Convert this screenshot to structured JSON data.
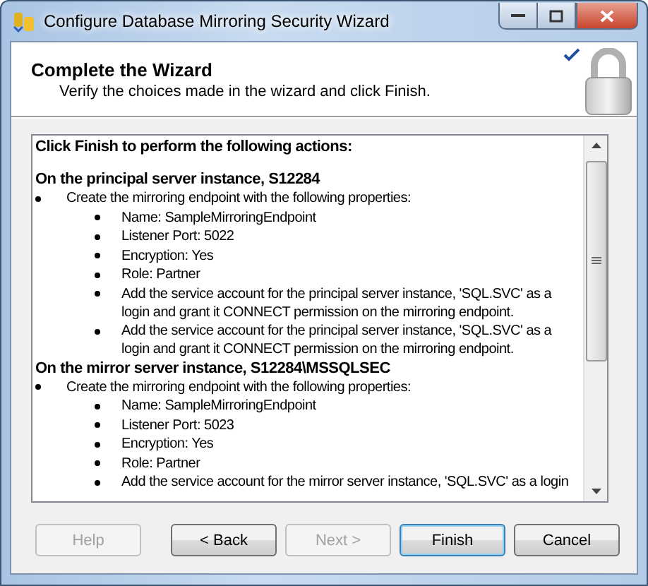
{
  "window": {
    "title": "Configure Database Mirroring Security Wizard"
  },
  "header": {
    "title": "Complete the Wizard",
    "subtitle": "Verify the choices made in the wizard and click Finish."
  },
  "summary": {
    "intro": "Click Finish to perform the following actions:",
    "sections": [
      {
        "heading": "On the principal server instance, S12284",
        "items": [
          {
            "text": "Create the mirroring endpoint with the following properties:",
            "children": [
              {
                "text": "Name: SampleMirroringEndpoint"
              },
              {
                "text": "Listener Port: 5022"
              },
              {
                "text": "Encryption: Yes"
              },
              {
                "text": "Role: Partner"
              },
              {
                "text": "Add the service account for the principal server instance, 'SQL.SVC' as a login and grant it CONNECT permission on the mirroring endpoint."
              },
              {
                "text": "Add the service account for the principal server instance, 'SQL.SVC' as a login and grant it CONNECT permission on the mirroring endpoint."
              }
            ]
          }
        ]
      },
      {
        "heading": "On the mirror server instance, S12284\\MSSQLSEC",
        "items": [
          {
            "text": "Create the mirroring endpoint with the following properties:",
            "children": [
              {
                "text": "Name: SampleMirroringEndpoint"
              },
              {
                "text": "Listener Port: 5023"
              },
              {
                "text": "Encryption: Yes"
              },
              {
                "text": "Role: Partner"
              },
              {
                "text": "Add the service account for the mirror server instance, 'SQL.SVC' as a login"
              }
            ]
          }
        ]
      }
    ]
  },
  "buttons": [
    {
      "label": "Help",
      "disabled": true,
      "default": false
    },
    {
      "label": "< Back",
      "disabled": false,
      "default": false
    },
    {
      "label": "Next >",
      "disabled": true,
      "default": false
    },
    {
      "label": "Finish",
      "disabled": false,
      "default": true
    },
    {
      "label": "Cancel",
      "disabled": false,
      "default": false
    }
  ]
}
